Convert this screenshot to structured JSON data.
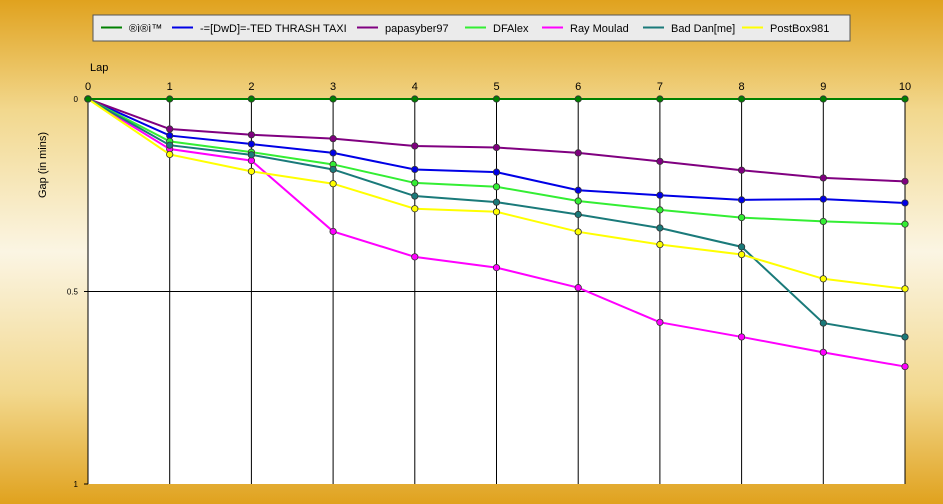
{
  "chart_data": {
    "type": "line",
    "xlabel": "Lap",
    "ylabel": "Gap (in mins)",
    "x": [
      0,
      1,
      2,
      3,
      4,
      5,
      6,
      7,
      8,
      9,
      10
    ],
    "xlim": [
      0,
      10
    ],
    "ylim": [
      0,
      1
    ],
    "y_ticks": [
      "0",
      "0.5",
      "1"
    ],
    "y_inverted": true,
    "grid": "x-gridlines-and-y-0.5",
    "legend_placement": "top",
    "series": [
      {
        "name": "®ì®ì™",
        "color": "#008000",
        "values": [
          0,
          0,
          0,
          0,
          0,
          0,
          0,
          0,
          0,
          0,
          0
        ]
      },
      {
        "name": "-=[DwD]=-TED THRASH TAXI",
        "color": "#0000e6",
        "values": [
          0,
          0.095,
          0.117,
          0.14,
          0.183,
          0.19,
          0.237,
          0.25,
          0.262,
          0.26,
          0.27
        ]
      },
      {
        "name": "papasyber97",
        "color": "#800080",
        "values": [
          0,
          0.078,
          0.093,
          0.103,
          0.122,
          0.126,
          0.14,
          0.162,
          0.185,
          0.205,
          0.214
        ]
      },
      {
        "name": "DFAlex",
        "color": "#33ee33",
        "values": [
          0,
          0.11,
          0.138,
          0.17,
          0.218,
          0.228,
          0.265,
          0.288,
          0.308,
          0.318,
          0.325
        ]
      },
      {
        "name": "Ray Moulad",
        "color": "#ff00ff",
        "values": [
          0,
          0.13,
          0.16,
          0.344,
          0.41,
          0.438,
          0.49,
          0.58,
          0.618,
          0.658,
          0.695
        ]
      },
      {
        "name": "Bad Dan[me]",
        "color": "#1a7a7a",
        "values": [
          0,
          0.12,
          0.145,
          0.183,
          0.252,
          0.268,
          0.3,
          0.335,
          0.384,
          0.582,
          0.618
        ]
      },
      {
        "name": "PostBox981",
        "color": "#ffff00",
        "values": [
          0,
          0.144,
          0.188,
          0.22,
          0.285,
          0.293,
          0.345,
          0.378,
          0.404,
          0.467,
          0.493
        ]
      }
    ]
  }
}
